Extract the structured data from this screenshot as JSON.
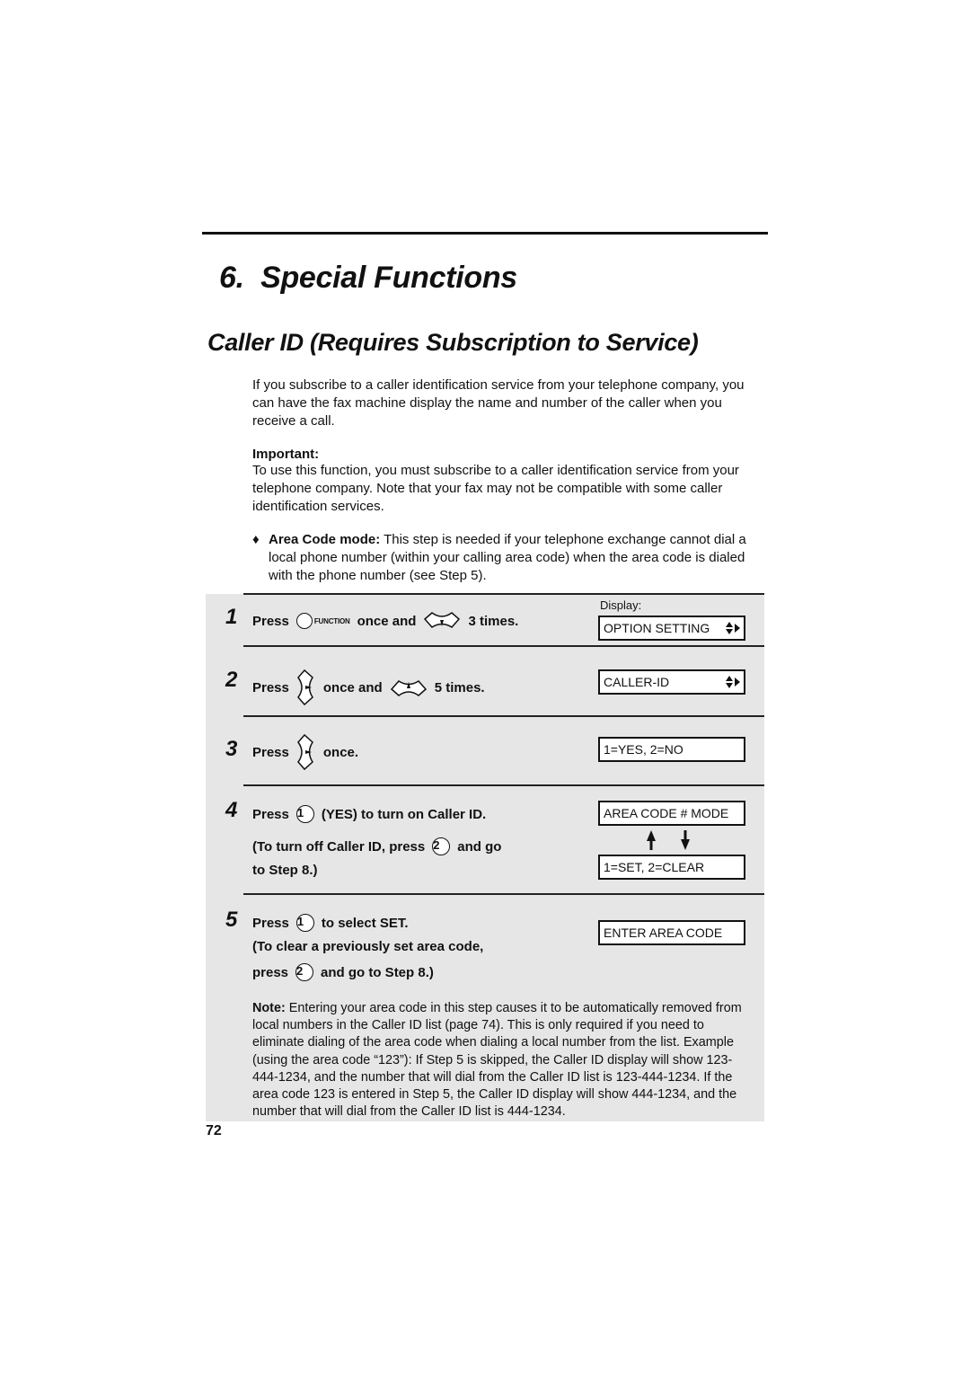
{
  "chapter": {
    "number": "6.",
    "title": "Special Functions"
  },
  "section": {
    "title": "Caller ID (Requires Subscription to Service)"
  },
  "intro": "If you subscribe to a caller identification service from your telephone company, you can have the fax machine display the name and number of the caller when you receive a call.",
  "important": {
    "label": "Important:",
    "text": "To use this function, you must subscribe to a caller identification service from your telephone company. Note that your fax may not be compatible with some caller identification services."
  },
  "bullet": {
    "symbol": "♦",
    "label": "Area Code mode:",
    "text": " This step is needed if your telephone exchange cannot dial a local phone number (within your calling area code) when the area code is dialed with the phone number (see Step 5)."
  },
  "display_label": "Display:",
  "steps": [
    {
      "num": "1",
      "press": "Press",
      "func_label": "FUNCTION",
      "mid": "once and",
      "end": "3 times."
    },
    {
      "num": "2",
      "press": "Press",
      "mid": "once and",
      "end": "5 times."
    },
    {
      "num": "3",
      "press": "Press",
      "end": "once."
    },
    {
      "num": "4",
      "press": "Press",
      "key1": "1",
      "text1": "(YES) to turn on Caller ID.",
      "sub_a": "(To turn off Caller ID, press",
      "key2": "2",
      "sub_b": "and go",
      "sub_c": "to Step 8.)"
    },
    {
      "num": "5",
      "press": "Press",
      "key1": "1",
      "text1": "to select SET.",
      "sub_a": "(To clear a previously set area code,",
      "sub_b_press": "press",
      "key2": "2",
      "sub_c": "and go to Step 8.)"
    }
  ],
  "displays": {
    "option_setting": "OPTION SETTING",
    "caller_id": "CALLER-ID",
    "yes_no": "1=YES, 2=NO",
    "area_code_mode": "AREA CODE # MODE",
    "set_clear": "1=SET, 2=CLEAR",
    "enter_area_code": "ENTER AREA CODE"
  },
  "note": {
    "label": "Note:",
    "text": " Entering your area code in this step causes it to be automatically removed from local numbers in the Caller ID list (page 74). This is only required if you need to eliminate dialing of the area code when dialing a local number from the list. Example (using the area code “123”): If Step 5 is skipped, the Caller ID display will show 123-444-1234, and the number that will dial from the Caller ID list is 123-444-1234. If the area code 123 is entered in Step 5, the Caller ID display will show 444-1234, and the number that will dial from the Caller ID list is 444-1234."
  },
  "page_number": "72"
}
